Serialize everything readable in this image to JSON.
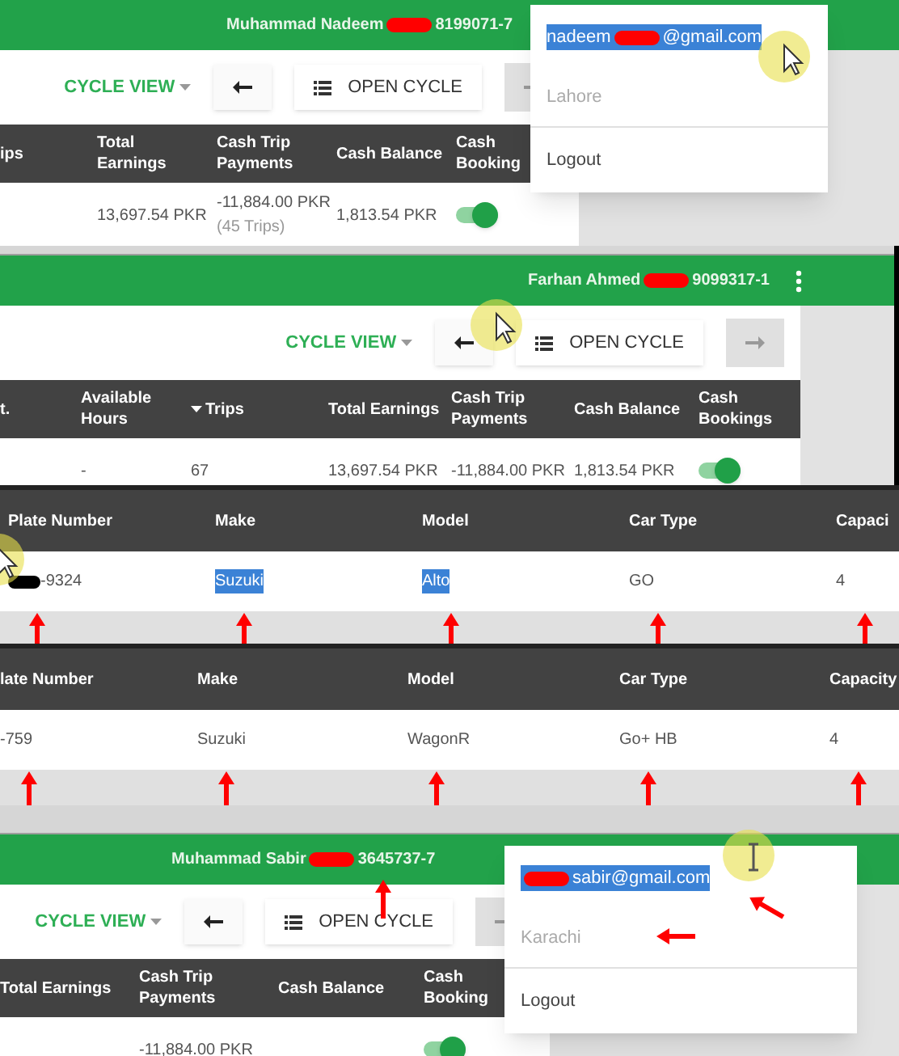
{
  "panels": [
    {
      "kind": "app",
      "header": {
        "title": [
          {
            "kind": "text",
            "text": "Muhammad Nadeem"
          },
          {
            "kind": "redacted",
            "color": "#ff0000"
          },
          {
            "kind": "text",
            "text": "8199071-7"
          }
        ]
      },
      "toolbar": {
        "view": "CYCLE VIEW",
        "open": "OPEN CYCLE",
        "next_disabled": true
      },
      "columns": [
        {
          "label": "ips",
          "sorted": false
        },
        {
          "label": "Total Earnings",
          "sorted": false
        },
        {
          "label": "Cash Trip Payments",
          "sorted": false
        },
        {
          "label": "Cash Balance",
          "sorted": false
        },
        {
          "label": "Cash Booking",
          "sorted": false
        }
      ],
      "row": [
        {
          "kind": "blank"
        },
        {
          "kind": "text",
          "text": "13,697.54 PKR"
        },
        {
          "kind": "text",
          "text": "-11,884.00 PKR",
          "note": "(45 Trips)"
        },
        {
          "kind": "text",
          "text": "1,813.54 PKR"
        },
        {
          "kind": "toggle",
          "on": true
        }
      ],
      "menu": {
        "email": {
          "parts": [
            {
              "kind": "text",
              "text": "nadeem"
            },
            {
              "kind": "redacted",
              "color": "#ff0000"
            },
            {
              "kind": "text",
              "text": "@gmail.com"
            }
          ],
          "selected": true,
          "marked": false
        },
        "city": {
          "text": "Lahore",
          "disabled": true,
          "marked": false
        },
        "logout": "Logout"
      }
    },
    {
      "kind": "app",
      "header": {
        "title": [
          {
            "kind": "text",
            "text": "Farhan Ahmed"
          },
          {
            "kind": "redacted",
            "color": "#ff0000"
          },
          {
            "kind": "text",
            "text": "9099317-1"
          }
        ],
        "more_icon": true
      },
      "toolbar": {
        "view": "CYCLE VIEW",
        "open": "OPEN CYCLE",
        "next_disabled": true
      },
      "columns": [
        {
          "label": "t.",
          "sorted": false
        },
        {
          "label": "Available Hours",
          "sorted": false
        },
        {
          "label": "Trips",
          "sorted": true
        },
        {
          "label": "Total Earnings",
          "sorted": false
        },
        {
          "label": "Cash Trip Payments",
          "sorted": false
        },
        {
          "label": "Cash Balance",
          "sorted": false
        },
        {
          "label": "Cash Bookings",
          "sorted": false
        }
      ],
      "row": [
        {
          "kind": "blank"
        },
        {
          "kind": "text",
          "text": "-"
        },
        {
          "kind": "text",
          "text": "67"
        },
        {
          "kind": "text",
          "text": "13,697.54 PKR"
        },
        {
          "kind": "text",
          "text": "-11,884.00 PKR"
        },
        {
          "kind": "text",
          "text": "1,813.54 PKR"
        },
        {
          "kind": "toggle",
          "on": true
        }
      ]
    },
    {
      "kind": "vehicles",
      "columns": [
        "Plate Number",
        "Make",
        "Model",
        "Car Type",
        "Capaci"
      ],
      "row": [
        {
          "text": "-9324",
          "redacted": true,
          "selected": false,
          "marked": true
        },
        {
          "text": "Suzuki",
          "redacted": false,
          "selected": true,
          "marked": true
        },
        {
          "text": "Alto",
          "redacted": false,
          "selected": true,
          "marked": true
        },
        {
          "text": "GO",
          "redacted": false,
          "selected": false,
          "marked": true
        },
        {
          "text": "4",
          "redacted": false,
          "selected": false,
          "marked": true
        }
      ]
    },
    {
      "kind": "vehicles",
      "columns": [
        "late Number",
        "Make",
        "Model",
        "Car Type",
        "Capacity"
      ],
      "row": [
        {
          "text": "-759",
          "redacted": false,
          "selected": false,
          "marked": true
        },
        {
          "text": "Suzuki",
          "redacted": false,
          "selected": false,
          "marked": true
        },
        {
          "text": "WagonR",
          "redacted": false,
          "selected": false,
          "marked": true
        },
        {
          "text": "Go+ HB",
          "redacted": false,
          "selected": false,
          "marked": true
        },
        {
          "text": "4",
          "redacted": false,
          "selected": false,
          "marked": true
        }
      ]
    },
    {
      "kind": "app",
      "header": {
        "title": [
          {
            "kind": "text",
            "text": "Muhammad Sabir"
          },
          {
            "kind": "redacted",
            "color": "#ff0000"
          },
          {
            "kind": "text",
            "text": "3645737-7"
          }
        ],
        "marked": true
      },
      "toolbar": {
        "view": "CYCLE VIEW",
        "open": "OPEN CYCLE",
        "next_disabled": true
      },
      "columns": [
        {
          "label": "Total Earnings",
          "sorted": false
        },
        {
          "label": "Cash Trip Payments",
          "sorted": false
        },
        {
          "label": "Cash Balance",
          "sorted": false
        },
        {
          "label": "Cash Booking",
          "sorted": false
        }
      ],
      "row": [
        {
          "kind": "blank"
        },
        {
          "kind": "text",
          "text": "-11,884.00 PKR"
        },
        {
          "kind": "blank"
        },
        {
          "kind": "toggle",
          "on": true
        }
      ],
      "menu": {
        "email": {
          "parts": [
            {
              "kind": "redacted",
              "color": "#ff0000"
            },
            {
              "kind": "text",
              "text": "sabir@gmail.com"
            }
          ],
          "selected": true,
          "marked": true
        },
        "city": {
          "text": "Karachi",
          "disabled": true,
          "marked": true
        },
        "logout": "Logout"
      }
    }
  ]
}
